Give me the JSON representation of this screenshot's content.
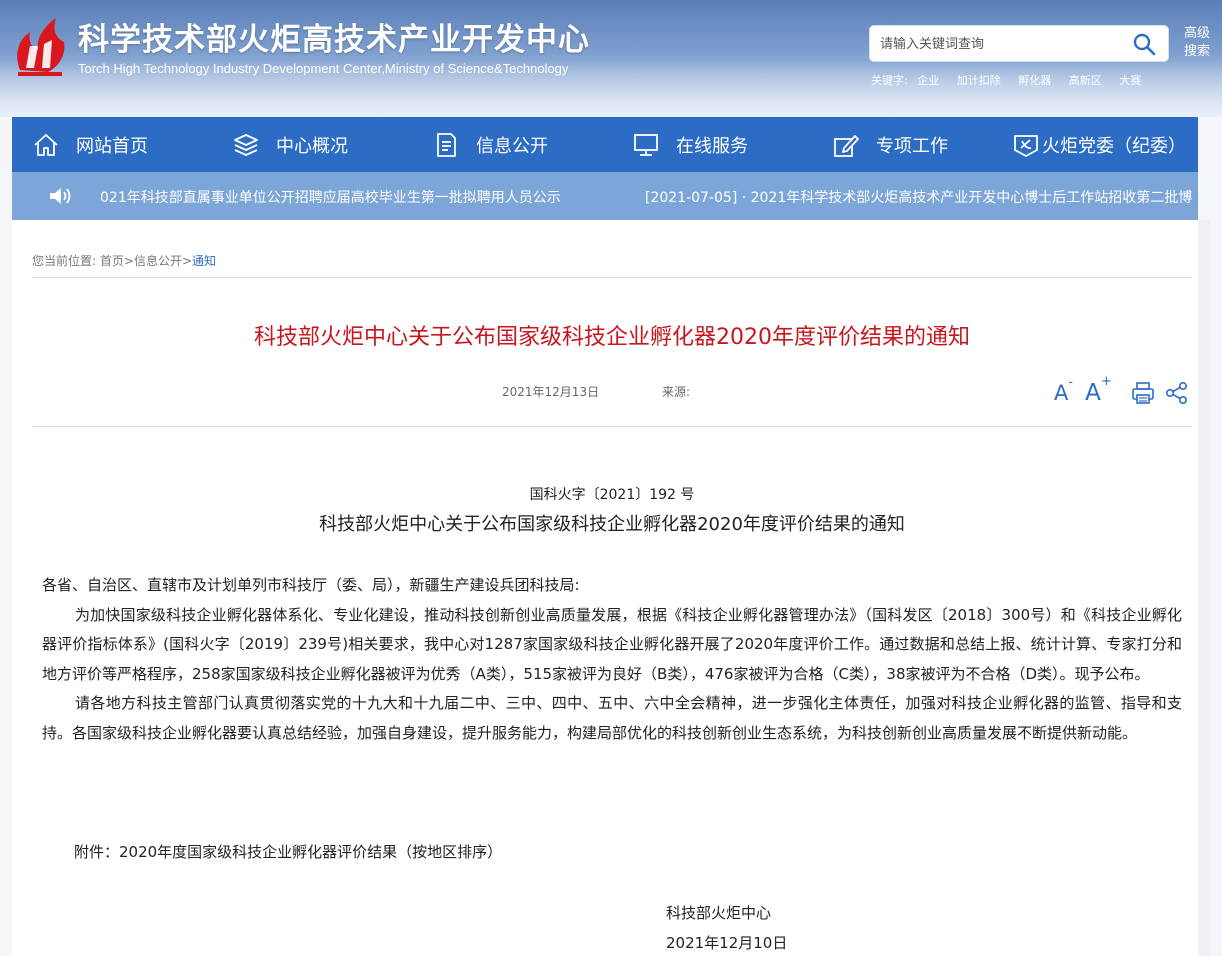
{
  "header": {
    "title": "科学技术部火炬高技术产业开发中心",
    "subtitle": "Torch High Technology Industry Development Center,Ministry of Science&Technology",
    "search_placeholder": "请输入关键词查询",
    "advanced_search": "高级搜索",
    "keywords_label": "关键字:",
    "keywords": [
      "企业",
      "加计扣除",
      "孵化器",
      "高新区",
      "大赛"
    ]
  },
  "nav": {
    "items": [
      "网站首页",
      "中心概况",
      "信息公开",
      "在线服务",
      "专项工作",
      "火炬党委（纪委）"
    ]
  },
  "ticker": {
    "left_text": "021年科技部直属事业单位公开招聘应届高校毕业生第一批拟聘用人员公示",
    "right_text": "[2021-07-05] · 2021年科学技术部火炬高技术产业开发中心博士后工作站招收第二批博"
  },
  "breadcrumb": {
    "label": "您当前位置:",
    "home": "首页",
    "sep1": ">",
    "info": "信息公开",
    "sep2": ">",
    "current": "通知"
  },
  "article": {
    "title": "科技部火炬中心关于公布国家级科技企业孵化器2020年度评价结果的通知",
    "date": "2021年12月13日",
    "source_label": "来源:",
    "doc_number": "国科火字〔2021〕192 号",
    "doc_title": "科技部火炬中心关于公布国家级科技企业孵化器2020年度评价结果的通知",
    "salutation": "各省、自治区、直辖市及计划单列市科技厅（委、局），新疆生产建设兵团科技局:",
    "paragraph1": "为加快国家级科技企业孵化器体系化、专业化建设，推动科技创新创业高质量发展，根据《科技企业孵化器管理办法》（国科发区〔2018〕300号）和《科技企业孵化器评价指标体系》(国科火字〔2019〕239号)相关要求，我中心对1287家国家级科技企业孵化器开展了2020年度评价工作。通过数据和总结上报、统计计算、专家打分和地方评价等严格程序，258家国家级科技企业孵化器被评为优秀（A类），515家被评为良好（B类），476家被评为合格（C类），38家被评为不合格（D类）。现予公布。",
    "paragraph2": "请各地方科技主管部门认真贯彻落实党的十九大和十九届二中、三中、四中、五中、六中全会精神，进一步强化主体责任，加强对科技企业孵化器的监管、指导和支持。各国家级科技企业孵化器要认真总结经验，加强自身建设，提升服务能力，构建局部优化的科技创新创业生态系统，为科技创新创业高质量发展不断提供新动能。",
    "attachment": "附件：2020年度国家级科技企业孵化器评价结果（按地区排序）",
    "signature": "科技部火炬中心",
    "sign_date": "2021年12月10日"
  },
  "tools": {
    "font_small": "A",
    "font_small_sup": "-",
    "font_large": "A",
    "font_large_sup": "+"
  },
  "colors": {
    "nav_bg": "#2c6cc4",
    "ticker_bg": "#7da6d8",
    "title_red": "#c8161d",
    "link_blue": "#2c6cc4"
  }
}
